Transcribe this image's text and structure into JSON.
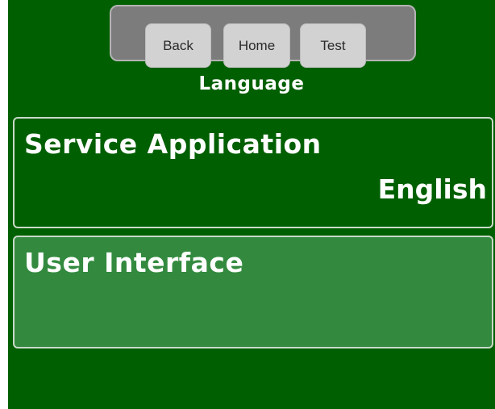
{
  "nav": {
    "back_label": "Back",
    "home_label": "Home",
    "test_label": "Test"
  },
  "screen": {
    "title": "Language"
  },
  "options": [
    {
      "label": "Service Application",
      "value": "English"
    },
    {
      "label": "User Interface",
      "value": ""
    }
  ],
  "colors": {
    "background": "#005f00",
    "selected_row": "#338a3f",
    "nav_bar": "#7c7c7c",
    "nav_button": "#d2d2d2",
    "text": "#ffffff"
  }
}
